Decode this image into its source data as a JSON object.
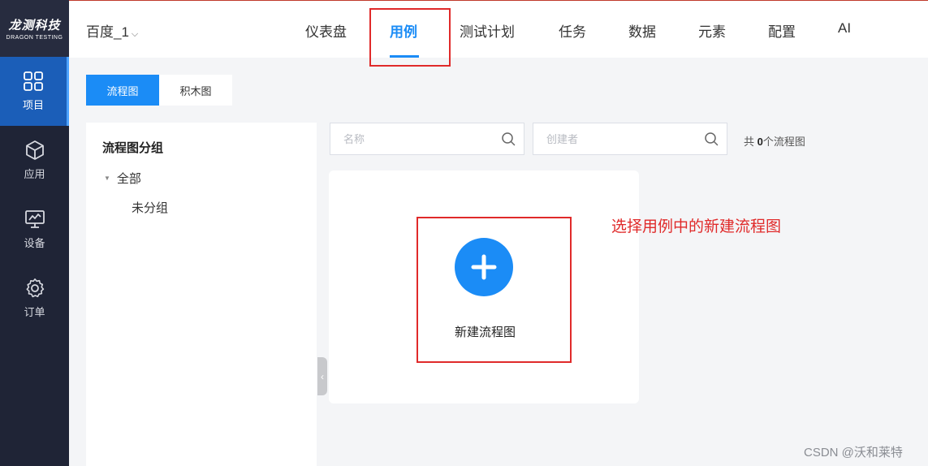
{
  "logo": {
    "main": "龙测科技",
    "sub": "DRAGON TESTING"
  },
  "sidebar": {
    "items": [
      {
        "label": "项目",
        "icon": "grid-icon",
        "active": true
      },
      {
        "label": "应用",
        "icon": "cube-icon",
        "active": false
      },
      {
        "label": "设备",
        "icon": "monitor-icon",
        "active": false
      },
      {
        "label": "订单",
        "icon": "gear-icon",
        "active": false
      }
    ]
  },
  "header": {
    "project": "百度_1",
    "nav": [
      {
        "label": "仪表盘",
        "active": false
      },
      {
        "label": "用例",
        "active": true
      },
      {
        "label": "测试计划",
        "active": false
      },
      {
        "label": "任务",
        "active": false
      },
      {
        "label": "数据",
        "active": false
      },
      {
        "label": "元素",
        "active": false
      },
      {
        "label": "配置",
        "active": false
      },
      {
        "label": "AI",
        "active": false
      }
    ]
  },
  "tabs": [
    {
      "label": "流程图",
      "active": true
    },
    {
      "label": "积木图",
      "active": false
    }
  ],
  "groups": {
    "title": "流程图分组",
    "all": "全部",
    "ungrouped": "未分组"
  },
  "search": {
    "name_placeholder": "名称",
    "creator_placeholder": "创建者"
  },
  "count": {
    "prefix": "共 ",
    "value": "0",
    "suffix": "个流程图"
  },
  "new_flow_label": "新建流程图",
  "annotation": "选择用例中的新建流程图",
  "watermark": "CSDN @沃和莱特",
  "colors": {
    "accent": "#1b8cf6",
    "highlight": "#e02a2a",
    "sidebar": "#1f2436"
  }
}
